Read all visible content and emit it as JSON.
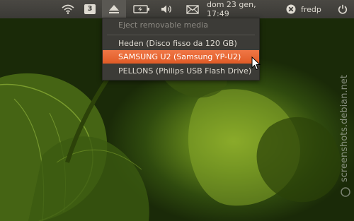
{
  "panel": {
    "workspace_number": "3",
    "clock": "dom 23 gen, 17:49",
    "username": "fredp"
  },
  "icons": {
    "wifi": "wifi-icon",
    "workspace": "workspace-switcher-icon",
    "eject": "eject-icon",
    "battery": "battery-icon",
    "volume": "volume-icon",
    "mail": "mail-icon",
    "user_status": "user-status-icon",
    "power": "power-icon"
  },
  "menu": {
    "header": "Eject removable media",
    "items": [
      {
        "label": "Heden (Disco fisso da 120 GB)",
        "highlighted": false
      },
      {
        "label": "SAMSUNG U2 (Samsung YP-U2)",
        "highlighted": true
      },
      {
        "label": "PELLONS (Philips USB Flash Drive)",
        "highlighted": false
      }
    ]
  },
  "watermark": "screenshots.debian.net",
  "colors": {
    "panel": "#3b3a36",
    "highlight": "#e8652e",
    "menu_bg": "#3c3b37",
    "text": "#dfdbd2"
  }
}
